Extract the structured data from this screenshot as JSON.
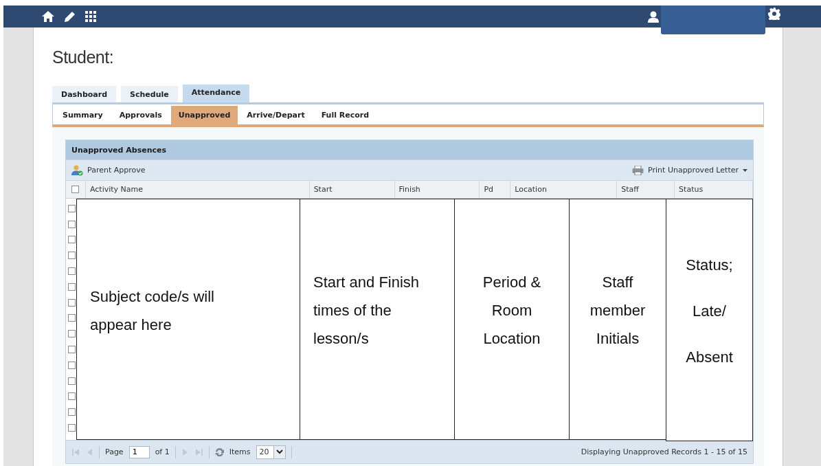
{
  "page_title": "Student:",
  "tabs": [
    {
      "label": "Dashboard",
      "selected": false
    },
    {
      "label": "Schedule",
      "selected": false
    },
    {
      "label": "Attendance",
      "selected": true
    }
  ],
  "subtabs": [
    {
      "label": "Summary",
      "selected": false
    },
    {
      "label": "Approvals",
      "selected": false
    },
    {
      "label": "Unapproved",
      "selected": true
    },
    {
      "label": "Arrive/Depart",
      "selected": false
    },
    {
      "label": "Full Record",
      "selected": false
    }
  ],
  "grid": {
    "title": "Unapproved Absences",
    "toolbar": {
      "left_action": "Parent Approve",
      "right_action": "Print Unapproved Letter"
    },
    "header_checkbox": {
      "checked": false
    },
    "columns": [
      "Activity Name",
      "Start",
      "Finish",
      "Pd",
      "Location",
      "Staff",
      "Status"
    ],
    "rows": [
      {
        "checked": false
      },
      {
        "checked": false
      },
      {
        "checked": false
      },
      {
        "checked": false
      },
      {
        "checked": false
      },
      {
        "checked": false
      },
      {
        "checked": false
      },
      {
        "checked": false
      },
      {
        "checked": false
      },
      {
        "checked": false
      },
      {
        "checked": false
      },
      {
        "checked": false
      },
      {
        "checked": false
      },
      {
        "checked": false
      },
      {
        "checked": false
      }
    ],
    "annotations": [
      "Subject code/s will\nappear here",
      "Start and Finish\ntimes of the\nlesson/s",
      "Period &\nRoom\nLocation",
      "Staff\nmember\nInitials",
      "Status;\nLate/\nAbsent"
    ],
    "pager": {
      "page_label": "Page",
      "page_value": "1",
      "of_label": "of 1",
      "items_label": "Items",
      "items_value": "20",
      "summary": "Displaying Unapproved Records 1 - 15 of 15"
    }
  }
}
